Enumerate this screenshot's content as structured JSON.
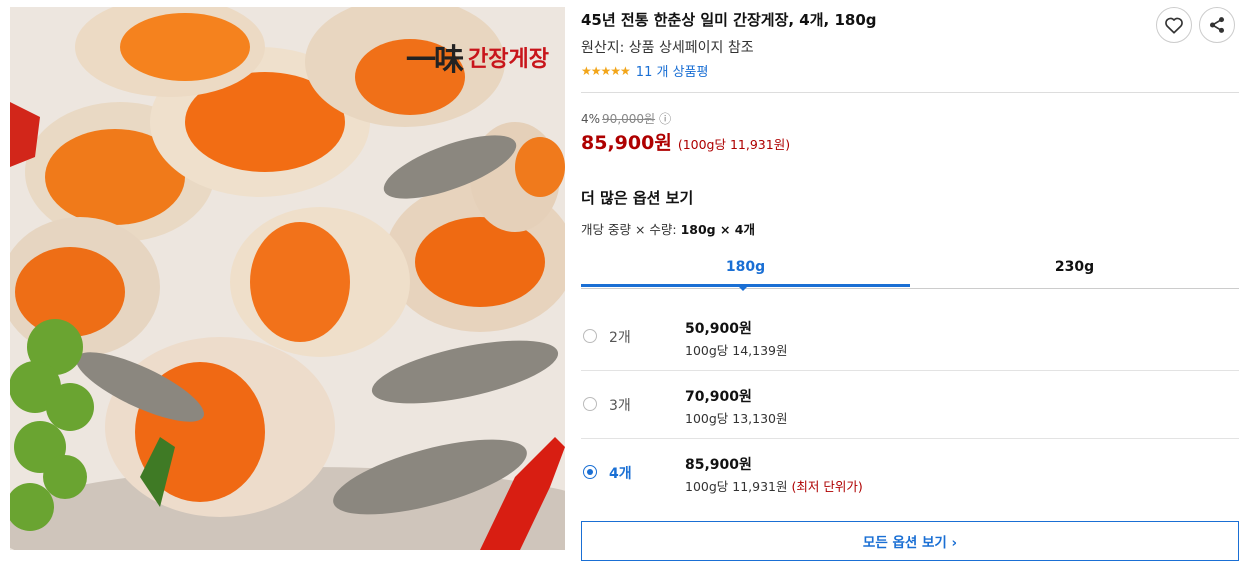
{
  "product": {
    "title": "45년 전통 한춘상 일미 간장게장, 4개, 180g",
    "origin": "원산지: 상품 상세페이지 참조",
    "stars": "★★★★★",
    "review_count": "11 개 상품평",
    "brand_logo_ink": "一味",
    "brand_logo_text": "간장게장"
  },
  "pricing": {
    "discount": "4%",
    "original_price": "90,000원",
    "info_icon": "ⓘ",
    "sale_price": "85,900원",
    "unit_price": "(100g당 11,931원)"
  },
  "options": {
    "section_title": "더 많은 옵션 보기",
    "weight_qty_label": "개당 중량 × 수량: ",
    "weight_qty_value": "180g × 4개",
    "tabs": [
      {
        "label": "180g",
        "active": true
      },
      {
        "label": "230g",
        "active": false
      }
    ],
    "rows": [
      {
        "qty": "2개",
        "price": "50,900원",
        "unit": "100g당 14,139원",
        "badge": "",
        "selected": false
      },
      {
        "qty": "3개",
        "price": "70,900원",
        "unit": "100g당 13,130원",
        "badge": "",
        "selected": false
      },
      {
        "qty": "4개",
        "price": "85,900원",
        "unit": "100g당 11,931원",
        "badge": "(최저 단위가)",
        "selected": true
      }
    ],
    "all_options_button": "모든 옵션 보기 ›"
  },
  "icons": {
    "wishlist": "heart-icon",
    "share": "share-icon"
  },
  "colors": {
    "accent": "#1a6fd4",
    "price_red": "#ae0000",
    "star": "#f2a519"
  }
}
